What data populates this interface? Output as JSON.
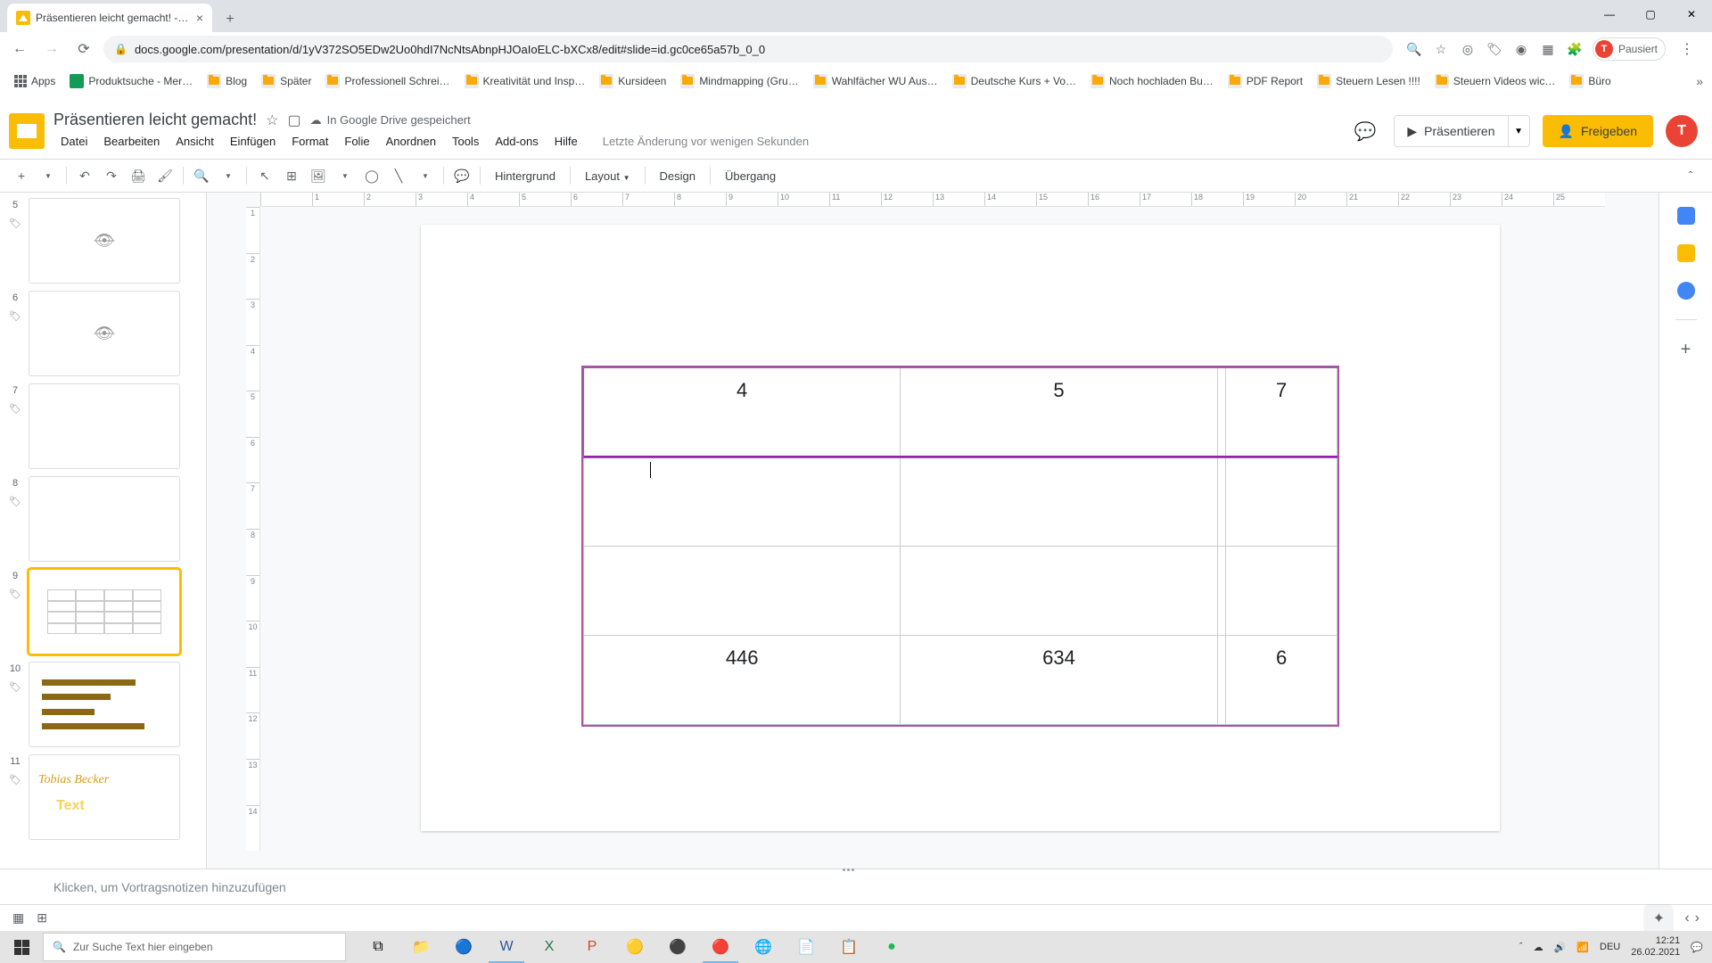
{
  "browser": {
    "tab_title": "Präsentieren leicht gemacht! - G…",
    "url": "docs.google.com/presentation/d/1yV372SO5EDw2Uo0hdI7NcNtsAbnpHJOaIoELC-bXCx8/edit#slide=id.gc0ce65a57b_0_0",
    "profile_status": "Pausiert",
    "bookmarks": [
      "Apps",
      "Produktsuche - Mer…",
      "Blog",
      "Später",
      "Professionell Schrei…",
      "Kreativität und Insp…",
      "Kursideen",
      "Mindmapping  (Gru…",
      "Wahlfächer WU Aus…",
      "Deutsche Kurs + Vo…",
      "Noch hochladen Bu…",
      "PDF Report",
      "Steuern Lesen !!!!",
      "Steuern Videos wic…",
      "Büro"
    ]
  },
  "app": {
    "doc_title": "Präsentieren leicht gemacht!",
    "drive_status": "In Google Drive gespeichert",
    "last_edit": "Letzte Änderung vor wenigen Sekunden",
    "menus": [
      "Datei",
      "Bearbeiten",
      "Ansicht",
      "Einfügen",
      "Format",
      "Folie",
      "Anordnen",
      "Tools",
      "Add-ons",
      "Hilfe"
    ],
    "present": "Präsentieren",
    "share": "Freigeben",
    "toolbar": {
      "bg": "Hintergrund",
      "layout": "Layout",
      "design": "Design",
      "transition": "Übergang"
    }
  },
  "ruler_h": [
    "",
    "1",
    "2",
    "3",
    "4",
    "5",
    "6",
    "7",
    "8",
    "9",
    "10",
    "11",
    "12",
    "13",
    "14",
    "15",
    "16",
    "17",
    "18",
    "19",
    "20",
    "21",
    "22",
    "23",
    "24",
    "25"
  ],
  "ruler_v": [
    "1",
    "2",
    "3",
    "4",
    "5",
    "6",
    "7",
    "8",
    "9",
    "10",
    "11",
    "12",
    "13",
    "14"
  ],
  "slides": [
    {
      "num": "5"
    },
    {
      "num": "6"
    },
    {
      "num": "7"
    },
    {
      "num": "8"
    },
    {
      "num": "9"
    },
    {
      "num": "10"
    },
    {
      "num": "11"
    }
  ],
  "table": {
    "rows": [
      [
        "4",
        "5",
        "",
        "7"
      ],
      [
        "",
        "",
        "",
        ""
      ],
      [
        "",
        "",
        "",
        ""
      ],
      [
        "446",
        "634",
        "",
        "6"
      ]
    ]
  },
  "notes_placeholder": "Klicken, um Vortragsnotizen hinzuzufügen",
  "taskbar": {
    "search_placeholder": "Zur Suche Text hier eingeben",
    "lang": "DEU",
    "time": "12:21",
    "date": "26.02.2021"
  }
}
